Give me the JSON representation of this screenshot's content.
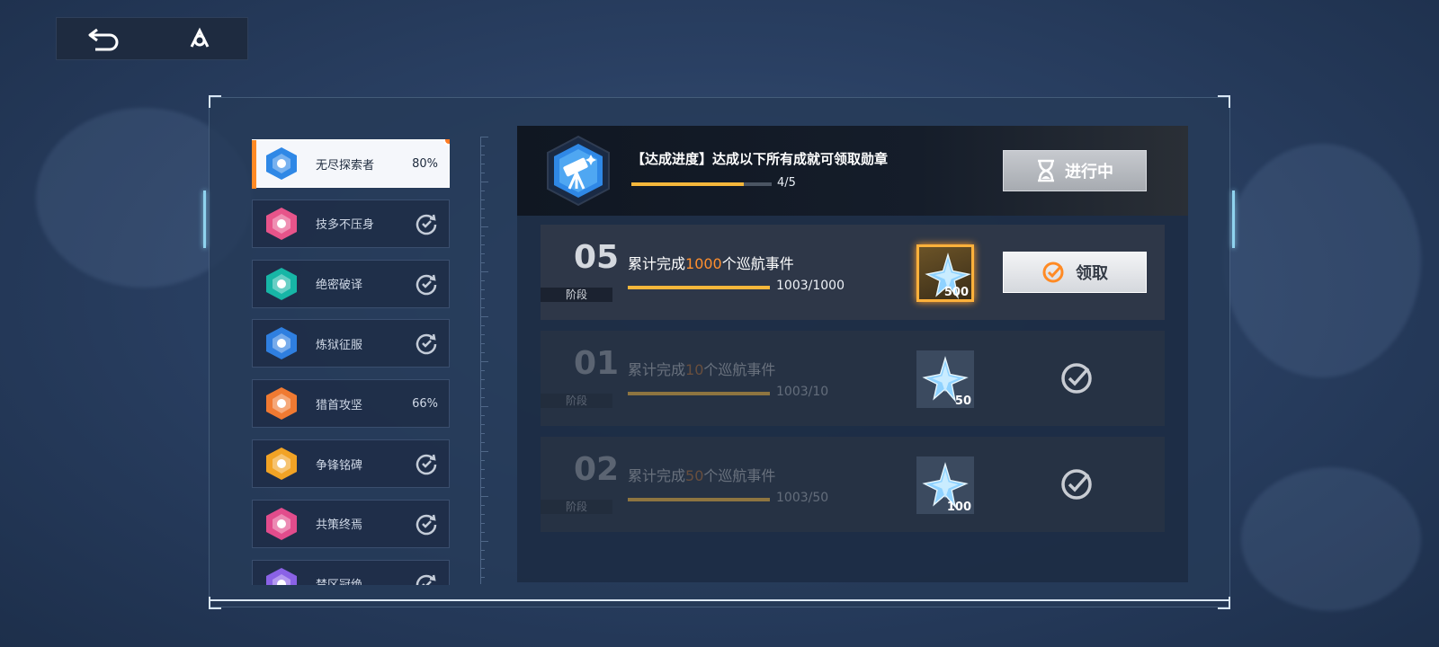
{
  "topbar": {
    "back_icon": "back-arrow-icon",
    "home_icon": "hub-icon"
  },
  "sidebar": {
    "items": [
      {
        "name": "无尽探索者",
        "pct": "80%",
        "status": "percent",
        "color": "#2f88e6",
        "active": true,
        "badge": true
      },
      {
        "name": "技多不压身",
        "pct": "",
        "status": "done",
        "color": "#e7548a"
      },
      {
        "name": "绝密破译",
        "pct": "",
        "status": "done",
        "color": "#17b6a6"
      },
      {
        "name": "炼狱征服",
        "pct": "",
        "status": "done",
        "color": "#2f7fe0"
      },
      {
        "name": "猎首攻坚",
        "pct": "66%",
        "status": "percent",
        "color": "#f07a32"
      },
      {
        "name": "争锋铭碑",
        "pct": "",
        "status": "done",
        "color": "#f2a325"
      },
      {
        "name": "共策终焉",
        "pct": "",
        "status": "done",
        "color": "#e24c8c"
      },
      {
        "name": "禁区冠绝",
        "pct": "",
        "status": "done",
        "color": "#8a62e6"
      }
    ]
  },
  "header": {
    "title": "【达成进度】达成以下所有成就可领取勋章",
    "progress": 0.8,
    "count": "4/5",
    "status_button": "进行中"
  },
  "tasks": [
    {
      "stage": "05",
      "stage_label": "阶段",
      "prefix": "累计完成",
      "num": "1000",
      "suffix": "个巡航事件",
      "progress": 1.0,
      "progress_text": "1003/1000",
      "reward": "500",
      "state": "claim",
      "claim_label": "领取"
    },
    {
      "stage": "01",
      "stage_label": "阶段",
      "prefix": "累计完成",
      "num": "10",
      "suffix": "个巡航事件",
      "progress": 1.0,
      "progress_text": "1003/10",
      "reward": "50",
      "state": "done"
    },
    {
      "stage": "02",
      "stage_label": "阶段",
      "prefix": "累计完成",
      "num": "50",
      "suffix": "个巡航事件",
      "progress": 1.0,
      "progress_text": "1003/50",
      "reward": "100",
      "state": "done"
    }
  ]
}
